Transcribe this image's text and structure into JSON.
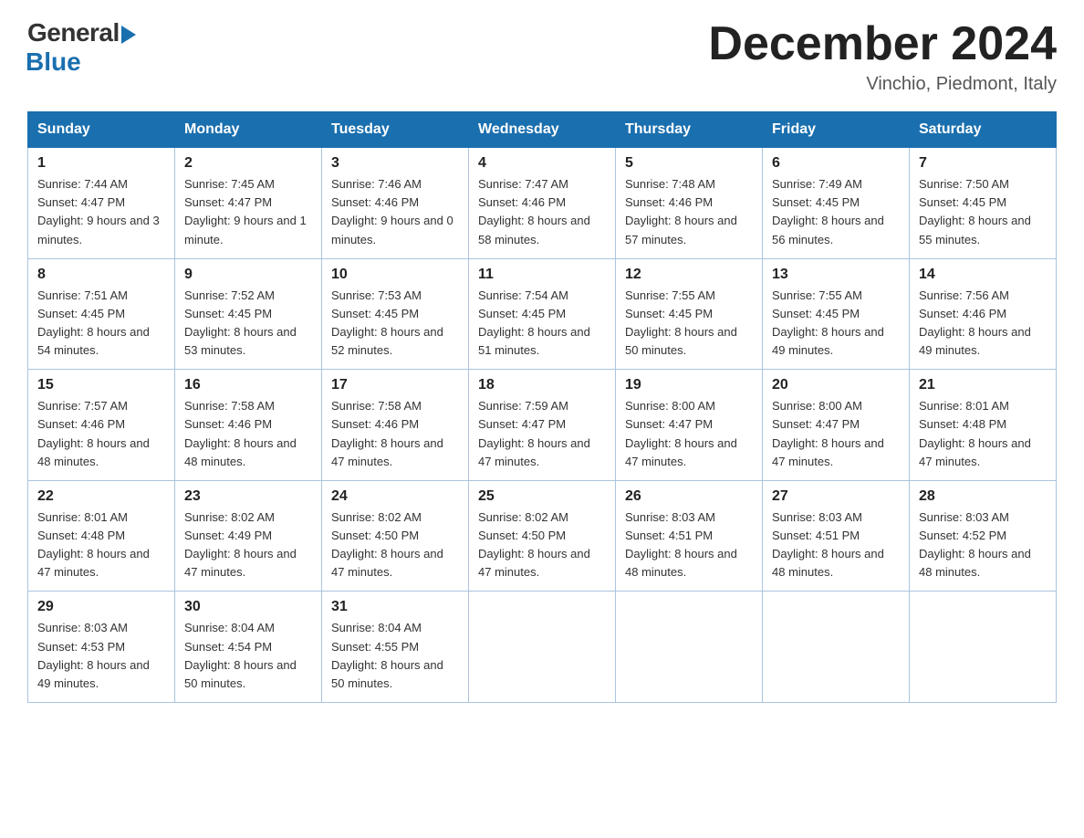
{
  "header": {
    "logo_general": "General",
    "logo_blue": "Blue",
    "title": "December 2024",
    "location": "Vinchio, Piedmont, Italy"
  },
  "days_of_week": [
    "Sunday",
    "Monday",
    "Tuesday",
    "Wednesday",
    "Thursday",
    "Friday",
    "Saturday"
  ],
  "weeks": [
    [
      {
        "day": "1",
        "sunrise": "7:44 AM",
        "sunset": "4:47 PM",
        "daylight": "9 hours and 3 minutes."
      },
      {
        "day": "2",
        "sunrise": "7:45 AM",
        "sunset": "4:47 PM",
        "daylight": "9 hours and 1 minute."
      },
      {
        "day": "3",
        "sunrise": "7:46 AM",
        "sunset": "4:46 PM",
        "daylight": "9 hours and 0 minutes."
      },
      {
        "day": "4",
        "sunrise": "7:47 AM",
        "sunset": "4:46 PM",
        "daylight": "8 hours and 58 minutes."
      },
      {
        "day": "5",
        "sunrise": "7:48 AM",
        "sunset": "4:46 PM",
        "daylight": "8 hours and 57 minutes."
      },
      {
        "day": "6",
        "sunrise": "7:49 AM",
        "sunset": "4:45 PM",
        "daylight": "8 hours and 56 minutes."
      },
      {
        "day": "7",
        "sunrise": "7:50 AM",
        "sunset": "4:45 PM",
        "daylight": "8 hours and 55 minutes."
      }
    ],
    [
      {
        "day": "8",
        "sunrise": "7:51 AM",
        "sunset": "4:45 PM",
        "daylight": "8 hours and 54 minutes."
      },
      {
        "day": "9",
        "sunrise": "7:52 AM",
        "sunset": "4:45 PM",
        "daylight": "8 hours and 53 minutes."
      },
      {
        "day": "10",
        "sunrise": "7:53 AM",
        "sunset": "4:45 PM",
        "daylight": "8 hours and 52 minutes."
      },
      {
        "day": "11",
        "sunrise": "7:54 AM",
        "sunset": "4:45 PM",
        "daylight": "8 hours and 51 minutes."
      },
      {
        "day": "12",
        "sunrise": "7:55 AM",
        "sunset": "4:45 PM",
        "daylight": "8 hours and 50 minutes."
      },
      {
        "day": "13",
        "sunrise": "7:55 AM",
        "sunset": "4:45 PM",
        "daylight": "8 hours and 49 minutes."
      },
      {
        "day": "14",
        "sunrise": "7:56 AM",
        "sunset": "4:46 PM",
        "daylight": "8 hours and 49 minutes."
      }
    ],
    [
      {
        "day": "15",
        "sunrise": "7:57 AM",
        "sunset": "4:46 PM",
        "daylight": "8 hours and 48 minutes."
      },
      {
        "day": "16",
        "sunrise": "7:58 AM",
        "sunset": "4:46 PM",
        "daylight": "8 hours and 48 minutes."
      },
      {
        "day": "17",
        "sunrise": "7:58 AM",
        "sunset": "4:46 PM",
        "daylight": "8 hours and 47 minutes."
      },
      {
        "day": "18",
        "sunrise": "7:59 AM",
        "sunset": "4:47 PM",
        "daylight": "8 hours and 47 minutes."
      },
      {
        "day": "19",
        "sunrise": "8:00 AM",
        "sunset": "4:47 PM",
        "daylight": "8 hours and 47 minutes."
      },
      {
        "day": "20",
        "sunrise": "8:00 AM",
        "sunset": "4:47 PM",
        "daylight": "8 hours and 47 minutes."
      },
      {
        "day": "21",
        "sunrise": "8:01 AM",
        "sunset": "4:48 PM",
        "daylight": "8 hours and 47 minutes."
      }
    ],
    [
      {
        "day": "22",
        "sunrise": "8:01 AM",
        "sunset": "4:48 PM",
        "daylight": "8 hours and 47 minutes."
      },
      {
        "day": "23",
        "sunrise": "8:02 AM",
        "sunset": "4:49 PM",
        "daylight": "8 hours and 47 minutes."
      },
      {
        "day": "24",
        "sunrise": "8:02 AM",
        "sunset": "4:50 PM",
        "daylight": "8 hours and 47 minutes."
      },
      {
        "day": "25",
        "sunrise": "8:02 AM",
        "sunset": "4:50 PM",
        "daylight": "8 hours and 47 minutes."
      },
      {
        "day": "26",
        "sunrise": "8:03 AM",
        "sunset": "4:51 PM",
        "daylight": "8 hours and 48 minutes."
      },
      {
        "day": "27",
        "sunrise": "8:03 AM",
        "sunset": "4:51 PM",
        "daylight": "8 hours and 48 minutes."
      },
      {
        "day": "28",
        "sunrise": "8:03 AM",
        "sunset": "4:52 PM",
        "daylight": "8 hours and 48 minutes."
      }
    ],
    [
      {
        "day": "29",
        "sunrise": "8:03 AM",
        "sunset": "4:53 PM",
        "daylight": "8 hours and 49 minutes."
      },
      {
        "day": "30",
        "sunrise": "8:04 AM",
        "sunset": "4:54 PM",
        "daylight": "8 hours and 50 minutes."
      },
      {
        "day": "31",
        "sunrise": "8:04 AM",
        "sunset": "4:55 PM",
        "daylight": "8 hours and 50 minutes."
      },
      null,
      null,
      null,
      null
    ]
  ],
  "labels": {
    "sunrise": "Sunrise:",
    "sunset": "Sunset:",
    "daylight": "Daylight:"
  }
}
